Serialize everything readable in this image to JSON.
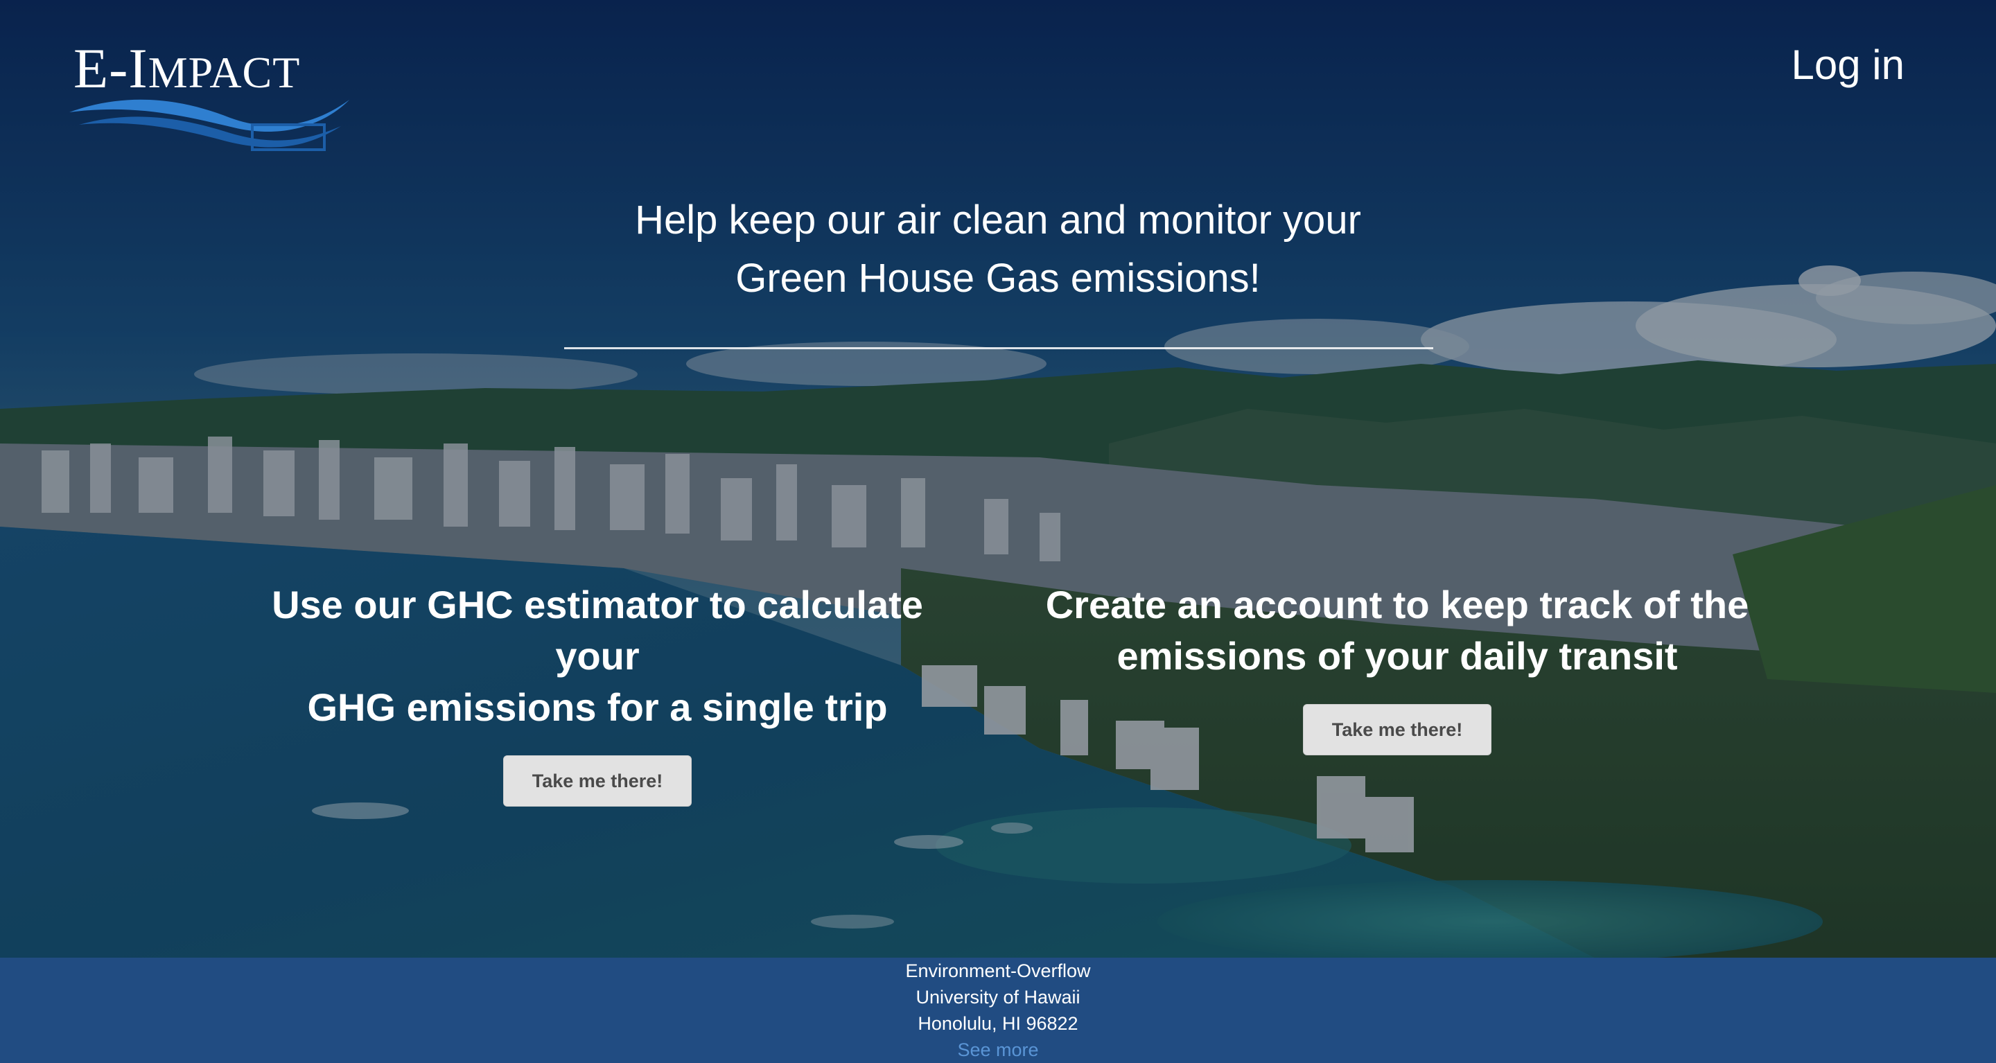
{
  "header": {
    "logo_text_big": "E-I",
    "logo_text_small": "MPACT",
    "login_label": "Log in"
  },
  "hero": {
    "headline_line1": "Help keep our air clean and monitor your",
    "headline_line2": "Green House Gas emissions!"
  },
  "features": [
    {
      "title_line1": "Use our GHC estimator to calculate your",
      "title_line2": "GHG emissions for a single trip",
      "button_label": "Take me there!"
    },
    {
      "title_line1": "Create an account to keep track of the",
      "title_line2": "emissions of your daily transit",
      "button_label": "Take me there!"
    }
  ],
  "footer": {
    "line1": "Environment-Overflow",
    "line2": "University of Hawaii",
    "line3": "Honolulu, HI 96822",
    "see_more": "See more"
  },
  "colors": {
    "footer_bg": "#214c82",
    "see_more_link": "#5a95d6",
    "button_bg": "#e2e2e2",
    "logo_wave": "#2f7fd0"
  },
  "icons": {
    "logo": "e-impact-wave-logo"
  }
}
